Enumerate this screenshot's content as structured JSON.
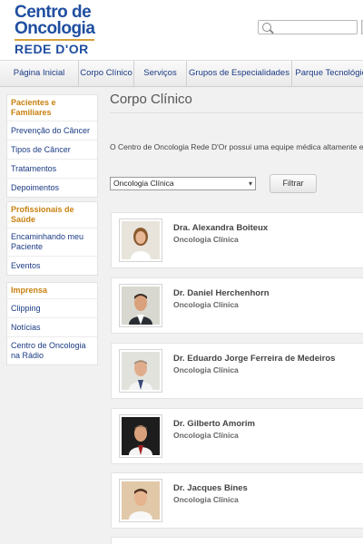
{
  "brand": {
    "line1": "Centro de",
    "line2": "Oncologia",
    "line3": "REDE D'OR",
    "color": "#1f4ea1",
    "accent": "#d7a03b"
  },
  "search": {
    "placeholder": "",
    "icon": "search-icon"
  },
  "nav": {
    "items": [
      {
        "label": "Página Inicial"
      },
      {
        "label": "Corpo Clínico"
      },
      {
        "label": "Serviços"
      },
      {
        "label": "Grupos de Especialidades"
      },
      {
        "label": "Parque Tecnológico"
      }
    ]
  },
  "sidebar": {
    "sections": [
      {
        "title": "Pacientes e Familiares",
        "links": [
          "Prevenção do Câncer",
          "Tipos de Câncer",
          "Tratamentos",
          "Depoimentos"
        ]
      },
      {
        "title": "Profissionais de Saúde",
        "links": [
          "Encaminhando meu Paciente",
          "Eventos"
        ]
      },
      {
        "title": "Imprensa",
        "links": [
          "Clipping",
          "Notícias",
          "Centro de Oncologia na Rádio"
        ]
      }
    ]
  },
  "main": {
    "title": "Corpo Clínico",
    "intro": "O Centro de Oncologia Rede D'Or possui uma equipe médica altamente especializada",
    "filter": {
      "selected": "Oncologia Clínica",
      "button": "Filtrar"
    },
    "doctors": [
      {
        "name": "Dra. Alexandra Boiteux",
        "specialty": "Oncologia Clínica"
      },
      {
        "name": "Dr. Daniel Herchenhorn",
        "specialty": "Oncologia Clínica"
      },
      {
        "name": "Dr. Eduardo Jorge Ferreira de Medeiros",
        "specialty": "Oncologia Clínica"
      },
      {
        "name": "Dr. Gilberto Amorim",
        "specialty": "Oncologia Clínica"
      },
      {
        "name": "Dr. Jacques Bines",
        "specialty": "Oncologia Clínica"
      }
    ]
  }
}
